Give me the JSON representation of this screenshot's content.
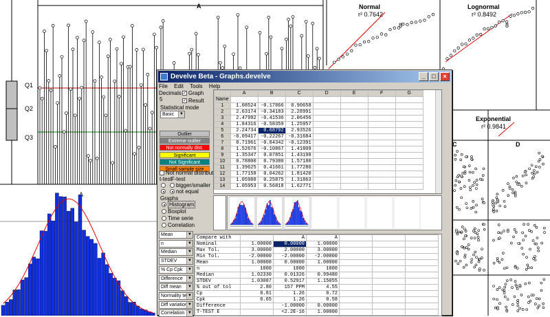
{
  "background_plots": {
    "top_chart": {
      "col_label": "A",
      "q_labels": [
        "Q1",
        "Q2",
        "Q3"
      ]
    },
    "hist_chart": {
      "label": "A"
    },
    "qq_plots": [
      {
        "title": "Normal",
        "r2": "r² 0.7642",
        "extra": "8"
      },
      {
        "title": "Lognormal",
        "r2": "r² 0.8492",
        "extra": "8"
      },
      {
        "title": "Exponential",
        "r2": "r² 0.9841"
      }
    ],
    "scatter_labels": [
      "C",
      "D"
    ]
  },
  "window": {
    "title": "Develve Beta - Graphs.develve",
    "title_buttons": [
      "_",
      "□",
      "×"
    ],
    "menu": [
      "File",
      "Edit",
      "Tools",
      "Help"
    ]
  },
  "controls": {
    "decimals_label": "Decimals",
    "decimals_value": "5",
    "graph_label": "Graph",
    "result_label": "Result",
    "stat_mode_label": "Statistical mode",
    "stat_mode_value": "Basic",
    "legend": [
      {
        "label": "Outlier",
        "bg": "#c0c0c0",
        "fg": "#000000"
      },
      {
        "label": "Extreme outlier",
        "bg": "#808080",
        "fg": "#ffffff"
      },
      {
        "label": "Not normally dist.",
        "bg": "#ff0000",
        "fg": "#ffffff"
      },
      {
        "label": "Significant",
        "bg": "#ffff00",
        "fg": "#000000"
      },
      {
        "label": "Not Significant",
        "bg": "#008080",
        "fg": "#ffffff"
      },
      {
        "label": "Small sample size",
        "bg": "#ff8000",
        "fg": "#000000"
      }
    ],
    "not_normal_label": "Not normal distributed",
    "ttest_label": "t-test",
    "ftest_label": "F-test",
    "bigger_smaller": "bigger/smaller",
    "not_equal": "not equal",
    "graphs_label": "Graphs",
    "graph_options": [
      "Histogram",
      "Boxplot",
      "Time serie",
      "Correlation"
    ],
    "stat_combos": [
      "Mean",
      "n",
      "Median",
      "STDEV",
      "% Cp Cpk",
      "Difference",
      "Diff mean",
      "Normality test",
      "Diff variation",
      "Correlation"
    ]
  },
  "grid1": {
    "name_header": "Name",
    "columns": [
      "A",
      "B",
      "C",
      "D",
      "E",
      "F",
      "G"
    ],
    "rows": [
      [
        "1",
        "1.08524",
        "-0.17866",
        "0.90658"
      ],
      [
        "2",
        "2.63174",
        "-0.34183",
        "2.28991"
      ],
      [
        "3",
        "2.47992",
        "-0.41536",
        "2.06456"
      ],
      [
        "4",
        "1.84316",
        "-0.58359",
        "1.25957"
      ],
      [
        "5",
        "2.24734",
        "0.68792",
        "2.93526"
      ],
      [
        "6",
        "-0.09417",
        "-0.22267",
        "-0.31684"
      ],
      [
        "7",
        "0.71961",
        "-0.84342",
        "-0.12391"
      ],
      [
        "8",
        "1.52676",
        "-0.10867",
        "1.41809"
      ],
      [
        "9",
        "1.35347",
        "0.07851",
        "1.43198"
      ],
      [
        "10",
        "0.78800",
        "0.79380",
        "1.57180"
      ],
      [
        "11",
        "1.39625",
        "0.41661",
        "1.77286"
      ],
      [
        "12",
        "1.77158",
        "0.04262",
        "1.81420"
      ],
      [
        "13",
        "1.05988",
        "0.25875",
        "1.31863"
      ],
      [
        "14",
        "1.05953",
        "0.56818",
        "1.62771"
      ]
    ],
    "selected": {
      "row": 4,
      "col": 2
    }
  },
  "grid2": {
    "header": [
      "Compare with",
      "",
      "A",
      "A"
    ],
    "rows": [
      [
        "Nominal",
        "1.00000",
        "0.00000",
        "1.00000"
      ],
      [
        "Max Tol.",
        "3.00000",
        "2.00000",
        "3.00000"
      ],
      [
        "Min Tol.",
        "-2.00000",
        "-2.00000",
        "-2.00000"
      ],
      [
        "Mean",
        "1.00000",
        "0.00000",
        "1.00000"
      ],
      [
        "n",
        "1000",
        "1000",
        "1000"
      ],
      [
        "Median",
        "1.02330",
        "0.01326",
        "0.99480"
      ],
      [
        "STDEV",
        "1.03087",
        "0.52917",
        "1.15055"
      ],
      [
        "% out of tol",
        "2.80",
        "157 PPM",
        "4.55"
      ],
      [
        "Cp",
        "0.81",
        "1.26",
        "0.72"
      ],
      [
        "Cpk",
        "0.65",
        "1.26",
        "0.58"
      ],
      [
        "Difference",
        "",
        "-1.00000",
        "0.00000"
      ],
      [
        "T-TEST E",
        "",
        "<2.2E-16",
        "1.00000"
      ]
    ],
    "selected": {
      "row": 0,
      "col": 2
    }
  }
}
